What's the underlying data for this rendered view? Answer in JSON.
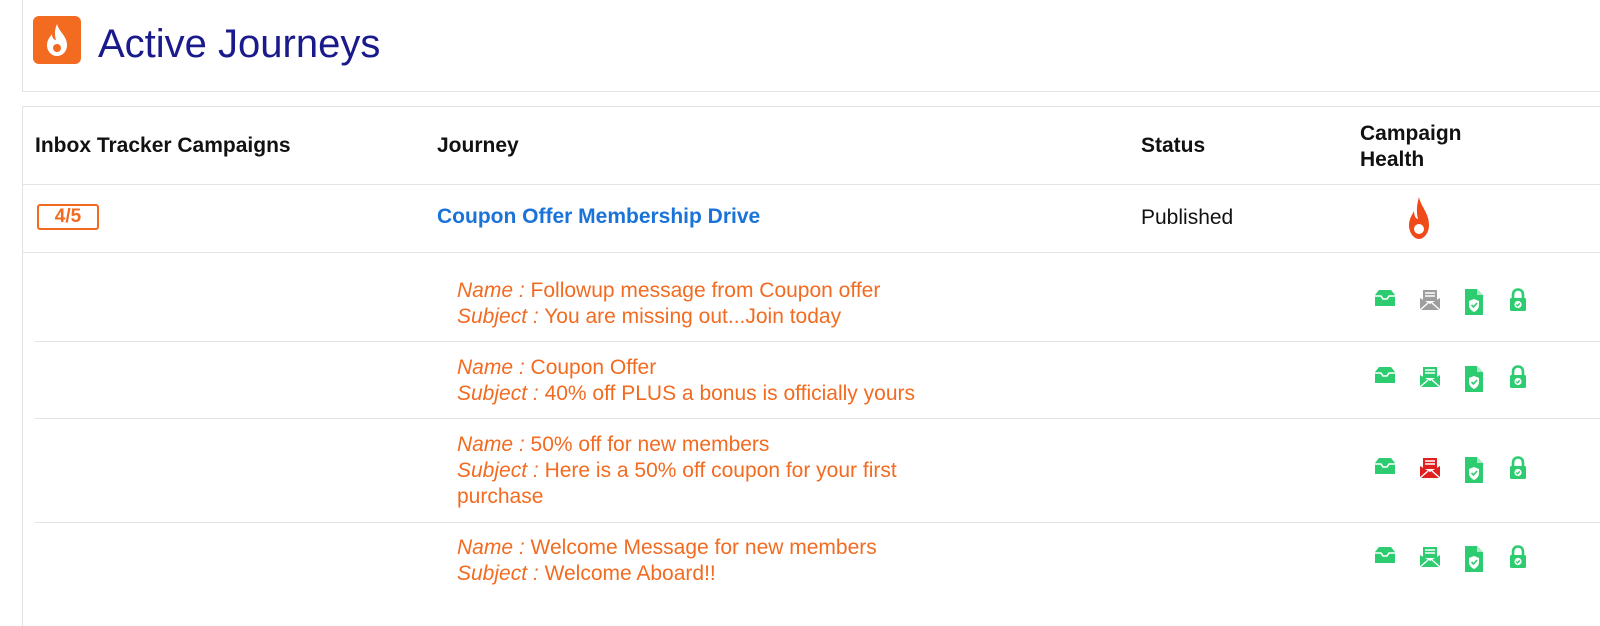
{
  "page": {
    "title": "Active Journeys",
    "logo_icon": "flame-logo-icon"
  },
  "table": {
    "columns": {
      "campaigns": "Inbox Tracker Campaigns",
      "journey": "Journey",
      "status": "Status",
      "health_line1": "Campaign",
      "health_line2": "Health"
    },
    "journey_row": {
      "badge": "4/5",
      "journey": "Coupon Offer Membership Drive",
      "status": "Published",
      "health_icon": "flame-icon"
    },
    "labels": {
      "name": "Name :",
      "subject": "Subject :"
    },
    "messages": [
      {
        "name": "Followup message from Coupon offer",
        "subject": "You are missing out...Join today",
        "deliverability_color": "#9e9e9e"
      },
      {
        "name": "Coupon Offer",
        "subject": "40% off PLUS a bonus is officially yours",
        "deliverability_color": "#2ecc71"
      },
      {
        "name": "50% off for new members",
        "subject": "Here is a 50% off coupon for your first purchase",
        "deliverability_color": "#e02020"
      },
      {
        "name": "Welcome Message for new members",
        "subject": "Welcome Aboard!!",
        "deliverability_color": "#2ecc71"
      }
    ],
    "health_icons": [
      "inbox-icon",
      "envelope-icon",
      "document-check-icon",
      "lock-icon"
    ]
  },
  "colors": {
    "accent": "#f26b21",
    "title": "#1a1a8c",
    "link": "#1a73d9",
    "ok": "#2ecc71",
    "bad": "#e02020",
    "neutral": "#9e9e9e"
  }
}
